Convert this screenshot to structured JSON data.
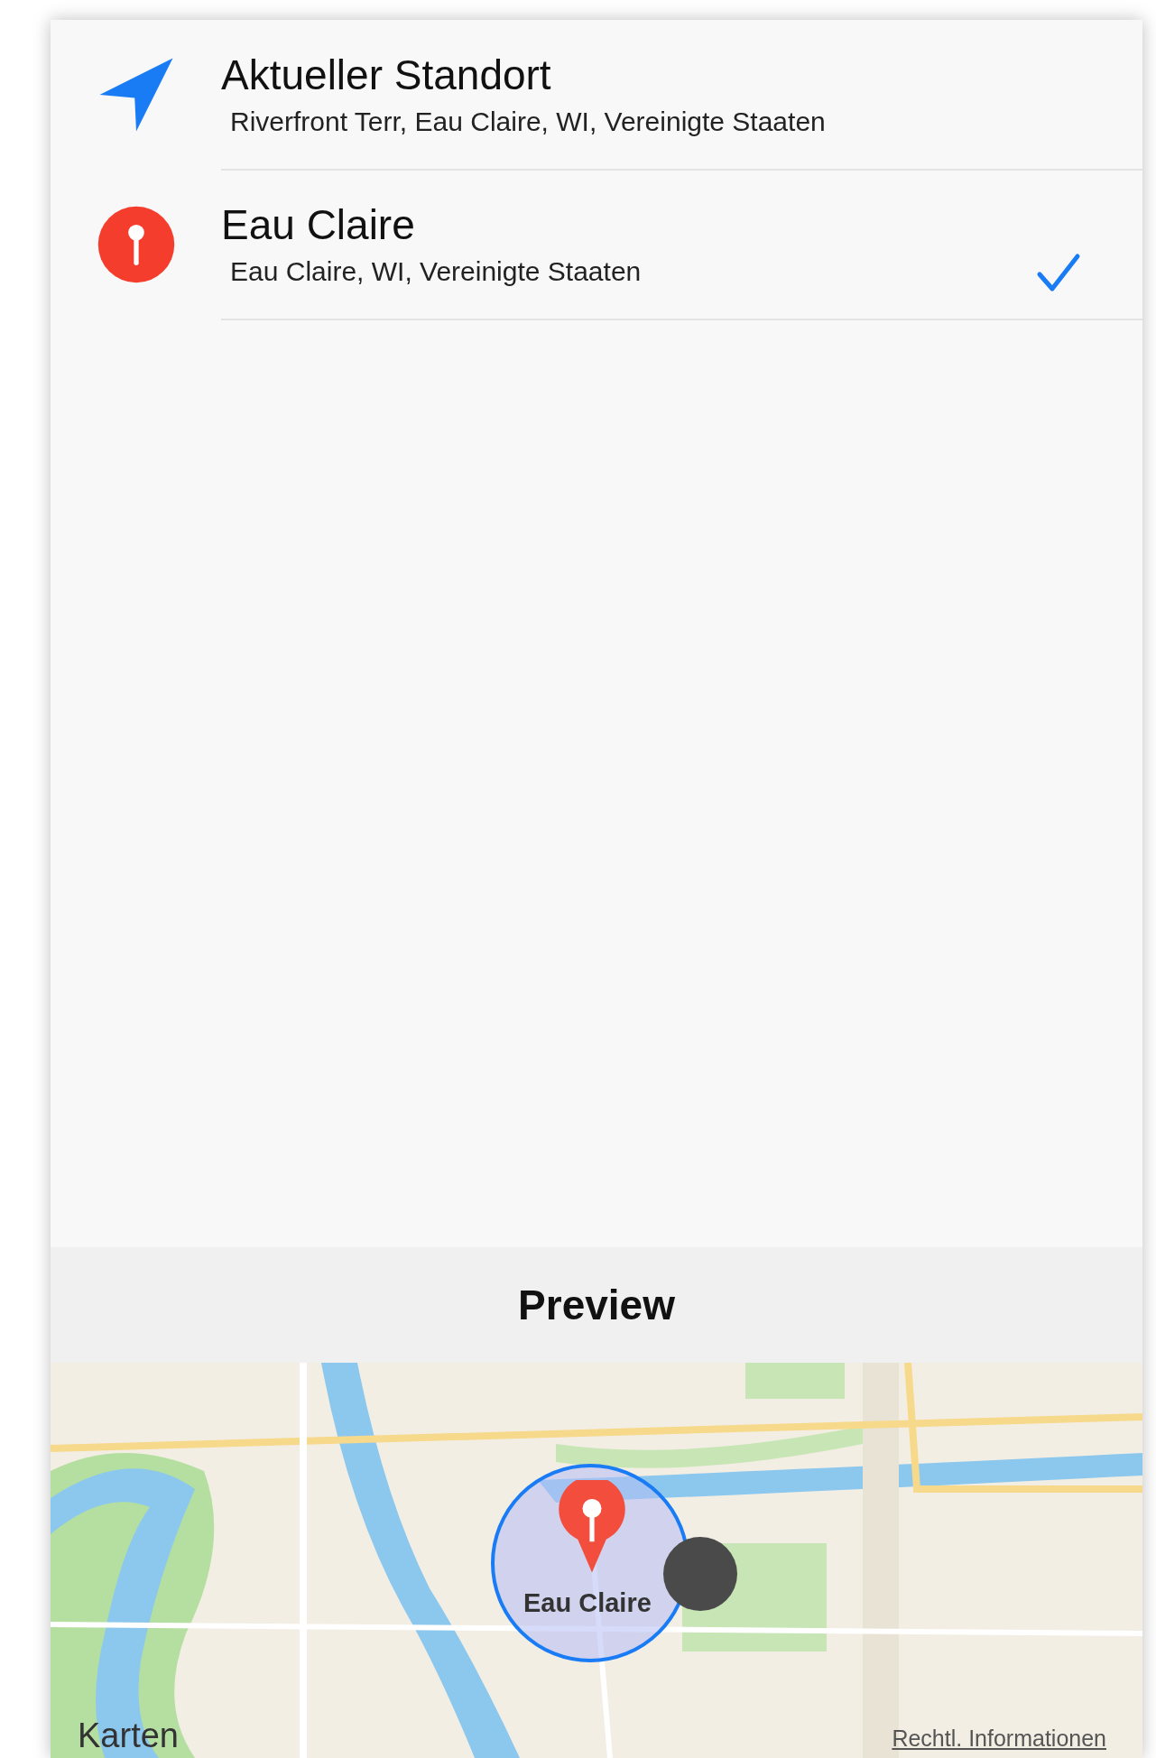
{
  "locations": [
    {
      "kind": "current",
      "title": "Aktueller Standort",
      "subtitle": "Riverfront Terr, Eau Claire, WI, Vereinigte Staaten",
      "selected": false
    },
    {
      "kind": "pin",
      "title": "Eau Claire",
      "subtitle": "Eau Claire, WI, Vereinigte Staaten",
      "selected": true
    }
  ],
  "preview": {
    "title": "Preview",
    "map": {
      "kind": "picture",
      "pin_label": "Eau Claire",
      "logo": "Karten",
      "legal_link": "Rechtl. Informationen"
    }
  }
}
